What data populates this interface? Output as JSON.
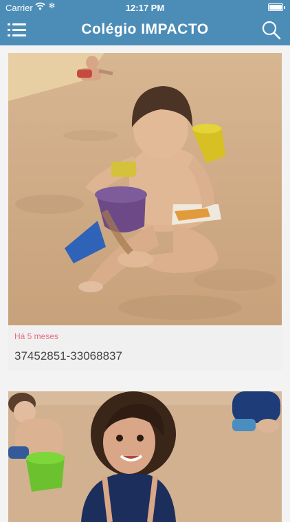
{
  "status_bar": {
    "carrier": "Carrier",
    "time": "12:17 PM"
  },
  "header": {
    "title": "Colégio IMPACTO",
    "menu_icon": "hamburger-menu-icon",
    "search_icon": "search-icon"
  },
  "feed": [
    {
      "date": "Há 5 meses",
      "title": "37452851-33068837",
      "photo": "child-playing-in-sand-photo"
    },
    {
      "photo": "smiling-girl-at-beach-photo"
    }
  ],
  "colors": {
    "header_bg": "#4c8db8",
    "date_text": "#e36d7f",
    "title_text": "#444444",
    "page_bg": "#f3f3f3"
  }
}
